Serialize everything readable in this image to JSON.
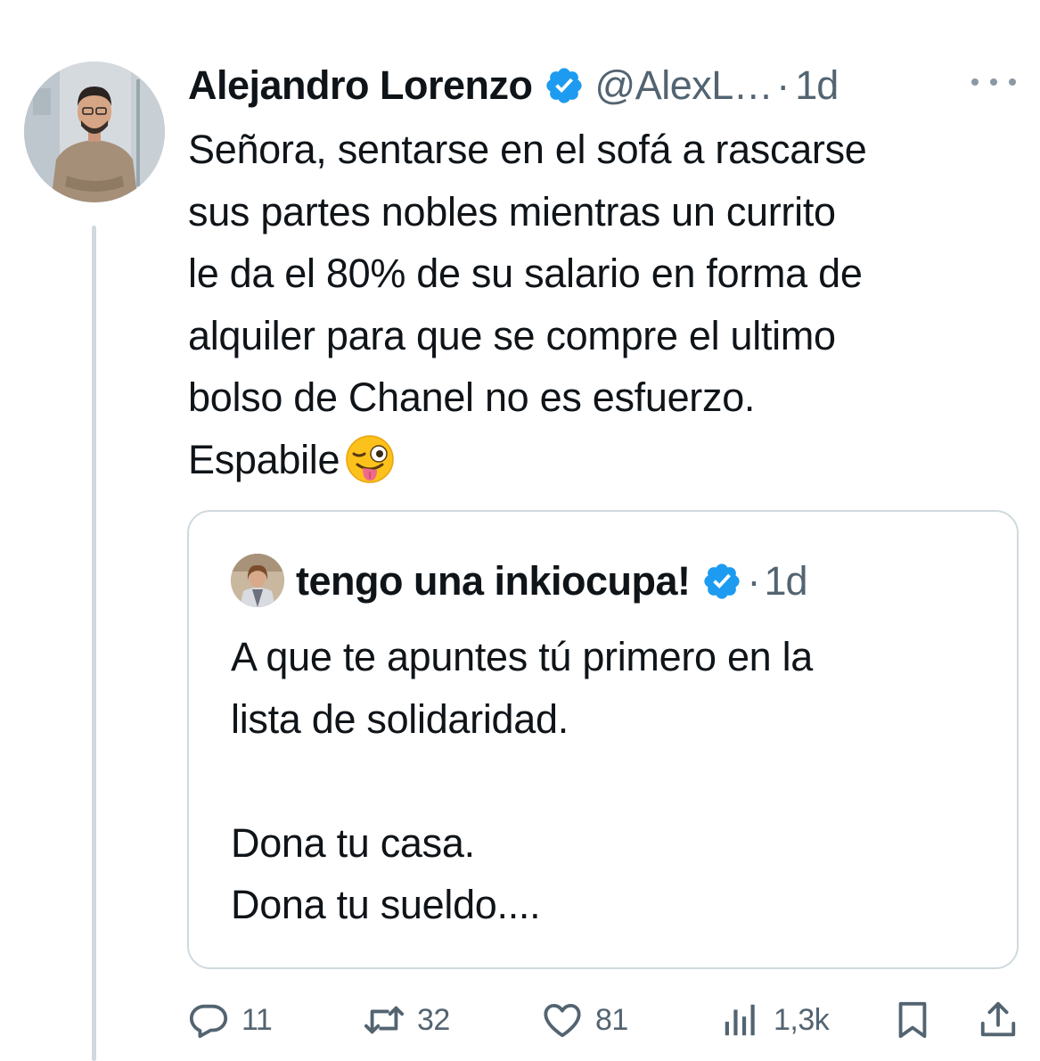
{
  "tweet": {
    "author_name": "Alejandro Lorenzo",
    "handle": "@AlexL…",
    "separator": "·",
    "time": "1d",
    "text_lines": [
      "Señora, sentarse en el sofá a rascarse",
      "sus partes nobles mientras un currito",
      "le da el 80% de su salario en forma de",
      "alquiler para que se compre el ultimo",
      "bolso de Chanel no es esfuerzo.",
      "Espabile"
    ],
    "emoji": "winking-face-with-tongue"
  },
  "quoted_tweet": {
    "author_name": "tengo una inkiocupa!",
    "separator": "·",
    "time": "1d",
    "text_lines": [
      "A que te apuntes tú primero en la",
      "lista de solidaridad.",
      "",
      "Dona tu casa.",
      "Dona tu sueldo...."
    ]
  },
  "actions": {
    "replies": "11",
    "retweets": "32",
    "likes": "81",
    "views": "1,3k"
  },
  "colors": {
    "text": "#0f1419",
    "secondary": "#536471",
    "verified": "#1d9bf0",
    "border": "#cfd9de"
  }
}
